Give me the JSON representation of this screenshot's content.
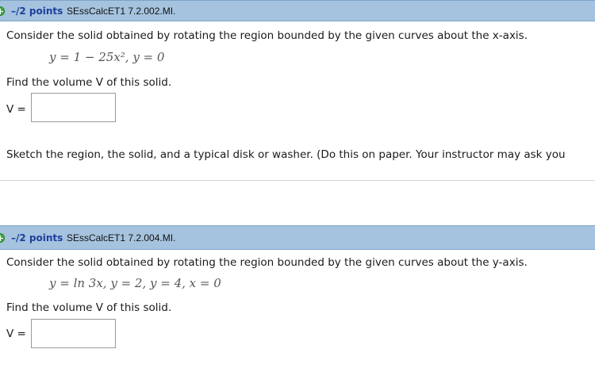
{
  "questions": [
    {
      "points": "–/2 points",
      "id": "SEssCalcET1 7.2.002.MI.",
      "prompt": "Consider the solid obtained by rotating the region bounded by the given curves about the x-axis.",
      "equation": "y = 1 − 25x², y = 0",
      "find": "Find the volume V of this solid.",
      "answer_label": "V =",
      "answer_value": "",
      "sketch": "Sketch the region, the solid, and a typical disk or washer. (Do this on paper. Your instructor may ask you"
    },
    {
      "points": "–/2 points",
      "id": "SEssCalcET1 7.2.004.MI.",
      "prompt": "Consider the solid obtained by rotating the region bounded by the given curves about the y-axis.",
      "equation": "y = ln 3x,  y = 2,  y = 4,  x = 0",
      "find": "Find the volume V of this solid.",
      "answer_label": "V =",
      "answer_value": ""
    }
  ],
  "icons": {
    "expand": "plus-circle-icon"
  },
  "colors": {
    "header_bg": "#a5c3de",
    "points_text": "#1f3f9e",
    "expand_icon": "#3fae3f"
  }
}
